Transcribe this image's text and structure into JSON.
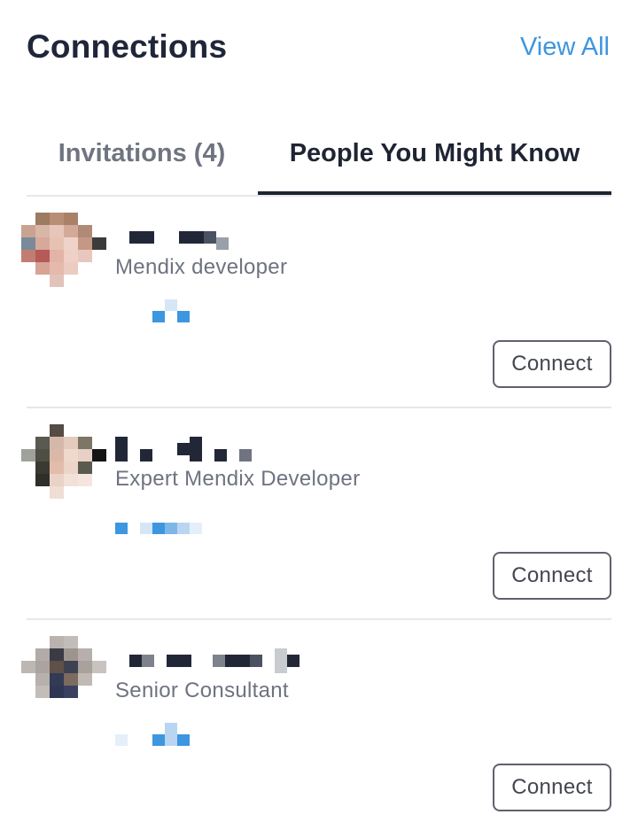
{
  "header": {
    "title": "Connections",
    "view_all_label": "View All"
  },
  "tabs": [
    {
      "label": "Invitations (4)",
      "active": false
    },
    {
      "label": "People You Might Know",
      "active": true
    }
  ],
  "people": [
    {
      "headline": "Mendix developer",
      "connect_label": "Connect"
    },
    {
      "headline": "Expert Mendix Developer",
      "connect_label": "Connect"
    },
    {
      "headline": "Senior Consultant",
      "connect_label": "Connect"
    }
  ],
  "colors": {
    "accent": "#3d96e0",
    "text_dark": "#1f2433",
    "text_muted": "#6e7380",
    "divider": "#e6e7ea"
  }
}
